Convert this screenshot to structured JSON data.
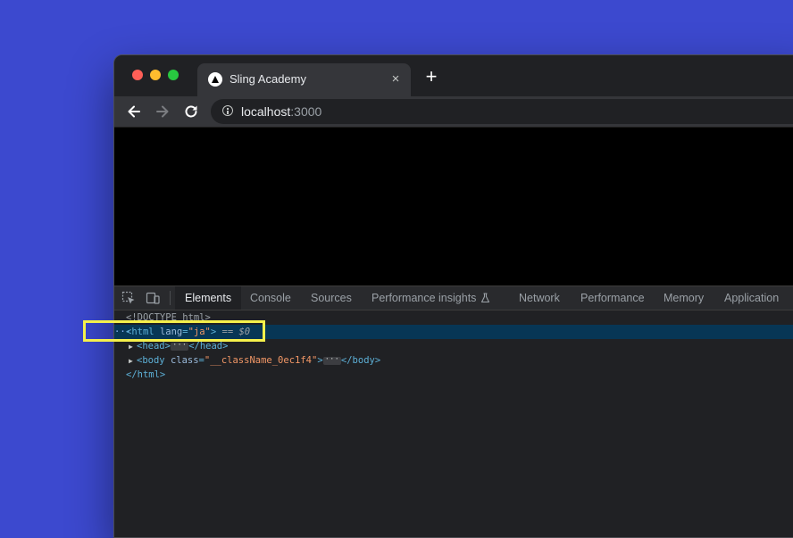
{
  "browser": {
    "tab": {
      "title": "Sling Academy",
      "close_icon": "×"
    },
    "new_tab_icon": "+",
    "address": {
      "host": "localhost",
      "port": ":3000"
    }
  },
  "devtools": {
    "tabs": [
      {
        "label": "Elements",
        "active": true
      },
      {
        "label": "Console"
      },
      {
        "label": "Sources"
      },
      {
        "label": "Performance insights"
      },
      {
        "label": "Network"
      },
      {
        "label": "Performance"
      },
      {
        "label": "Memory"
      },
      {
        "label": "Application"
      }
    ],
    "dom": {
      "doctype": "<!DOCTYPE html>",
      "html_open": "<html",
      "html_attr_name": "lang",
      "html_attr_value": "\"ja\"",
      "html_open_close": ">",
      "selected_marker": "== $0",
      "head_open": "<head>",
      "head_close": "</head>",
      "body_open": "<body",
      "body_attr_name": "class",
      "body_attr_value": "\"__className_0ec1f4\"",
      "body_open_close": ">",
      "body_close": "</body>",
      "html_close": "</html>",
      "ellipsis": "···",
      "row_dots": "···"
    }
  },
  "colors": {
    "desktop": "#3c49cf",
    "highlight": "#f5f04b",
    "selected_row": "#073655"
  }
}
